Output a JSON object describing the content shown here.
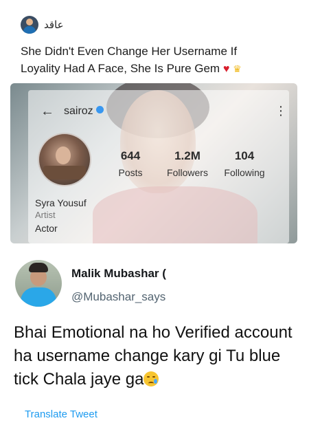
{
  "post": {
    "author_name": "عاقد",
    "caption_line1": "She Didn't Even Change Her Username If",
    "caption_line2": "Loyality Had A Face, She Is Pure Gem"
  },
  "profile_screenshot": {
    "username": "sairoz",
    "stats": [
      {
        "value": "644",
        "label": "Posts"
      },
      {
        "value": "1.2M",
        "label": "Followers"
      },
      {
        "value": "104",
        "label": "Following"
      }
    ],
    "name": "Syra Yousuf",
    "category": "Artist",
    "bio": "Actor"
  },
  "tweet": {
    "display_name": "Malik Mubashar (",
    "handle": "@Mubashar_says",
    "text": "Bhai Emotional na ho Verified account ha username change kary gi Tu blue tick Chala jaye ga",
    "translate_label": "Translate Tweet"
  }
}
